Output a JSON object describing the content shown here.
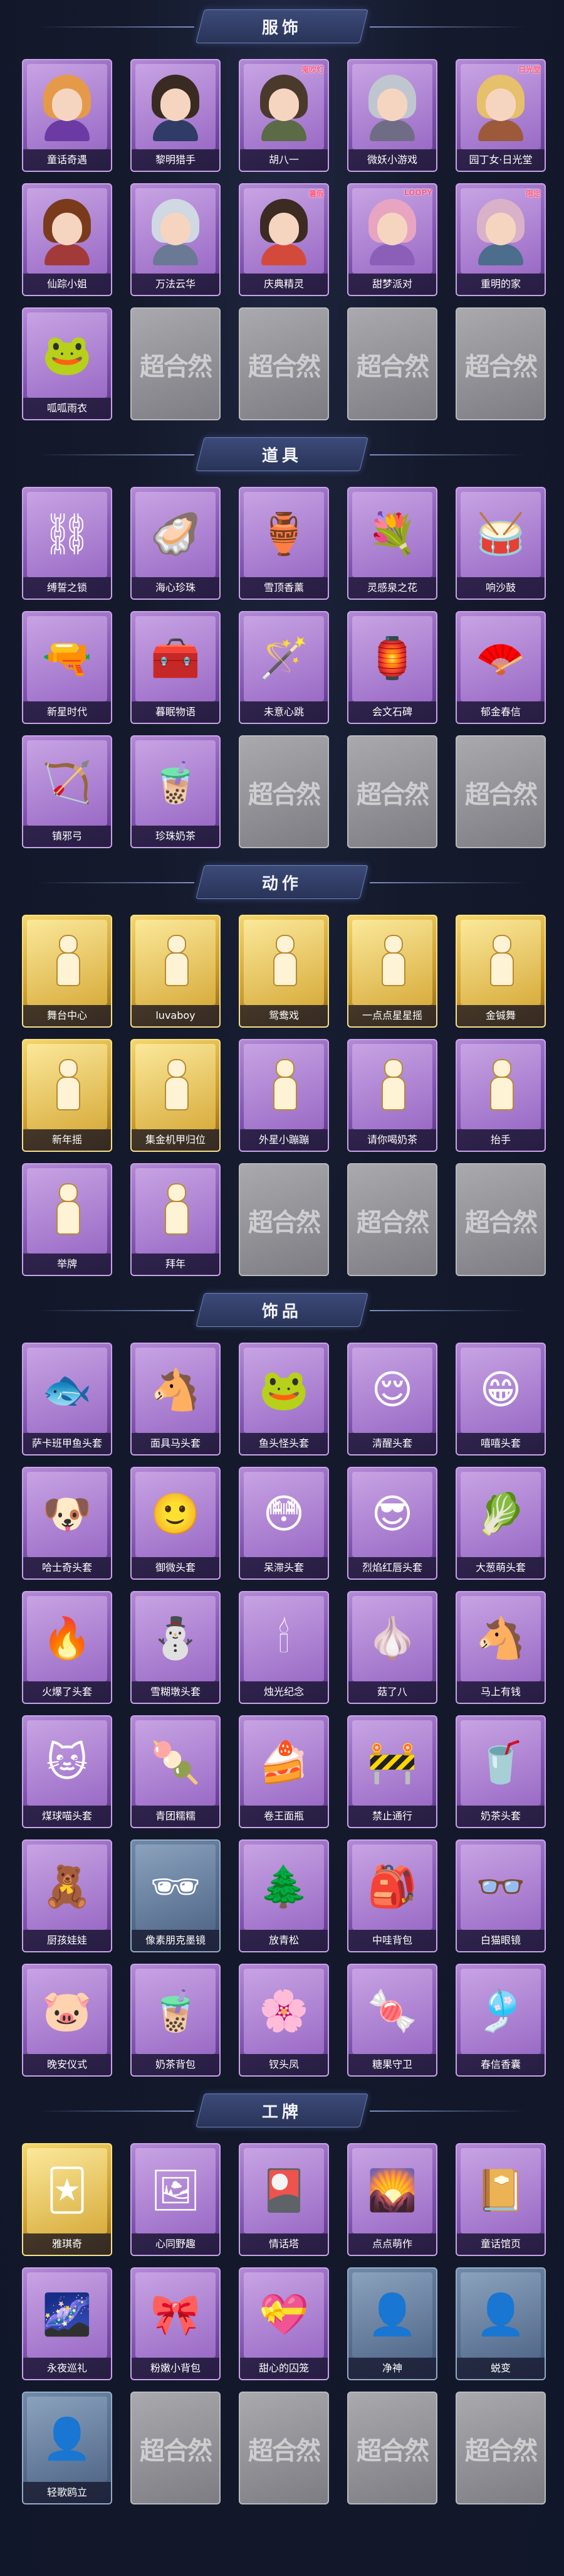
{
  "watermark": "超合然",
  "sections": [
    {
      "title": "服饰",
      "items": [
        {
          "label": "童话奇遇",
          "style": "purple",
          "kind": "portrait",
          "hair": "#e59a4a",
          "body": "#6b3aa3"
        },
        {
          "label": "黎明猎手",
          "style": "purple",
          "kind": "portrait",
          "hair": "#3a2b22",
          "body": "#2f3c66"
        },
        {
          "label": "胡八一",
          "style": "purple",
          "kind": "portrait",
          "hair": "#4a3a2c",
          "body": "#5a6b45",
          "tag": "鬼吹灯"
        },
        {
          "label": "微妖小游戏",
          "style": "purple",
          "kind": "portrait",
          "hair": "#bfc6cf",
          "body": "#6f6d86"
        },
        {
          "label": "园丁女·日光堂",
          "style": "purple",
          "kind": "portrait",
          "hair": "#e6c06a",
          "body": "#9c5a3a",
          "tag": "日光堂"
        },
        {
          "label": "仙踪小姐",
          "style": "purple",
          "kind": "portrait",
          "hair": "#7a3b1c",
          "body": "#a33a3a"
        },
        {
          "label": "万法云华",
          "style": "purple",
          "kind": "portrait",
          "hair": "#cfd8e3",
          "body": "#6a7a94"
        },
        {
          "label": "庆典精灵",
          "style": "purple",
          "kind": "portrait",
          "hair": "#3b2b22",
          "body": "#d34a3a",
          "tag": "暑假"
        },
        {
          "label": "甜梦派对",
          "style": "purple",
          "kind": "portrait",
          "hair": "#e7a5c2",
          "body": "#8b5fb7",
          "tag": "LOOPY"
        },
        {
          "label": "重明的家",
          "style": "purple",
          "kind": "portrait",
          "hair": "#d9b2c9",
          "body": "#4d6d8c",
          "tag": "限定"
        },
        {
          "label": "呱呱雨衣",
          "style": "purple",
          "kind": "emoji",
          "icon": "🐸"
        },
        {
          "label": "",
          "style": "empty"
        },
        {
          "label": "",
          "style": "empty"
        },
        {
          "label": "",
          "style": "empty"
        },
        {
          "label": "",
          "style": "empty"
        }
      ]
    },
    {
      "title": "道具",
      "items": [
        {
          "label": "缚誓之锁",
          "style": "purple",
          "kind": "emoji",
          "icon": "⛓"
        },
        {
          "label": "海心珍珠",
          "style": "purple",
          "kind": "emoji",
          "icon": "🦪"
        },
        {
          "label": "雪顶香薰",
          "style": "purple",
          "kind": "emoji",
          "icon": "🏺"
        },
        {
          "label": "灵感泉之花",
          "style": "purple",
          "kind": "emoji",
          "icon": "💐"
        },
        {
          "label": "响沙鼓",
          "style": "purple",
          "kind": "emoji",
          "icon": "🥁"
        },
        {
          "label": "新星时代",
          "style": "purple",
          "kind": "emoji",
          "icon": "🔫"
        },
        {
          "label": "暮眠物语",
          "style": "purple",
          "kind": "emoji",
          "icon": "🧰"
        },
        {
          "label": "未意心跳",
          "style": "purple",
          "kind": "emoji",
          "icon": "🪄"
        },
        {
          "label": "会文石碑",
          "style": "purple",
          "kind": "emoji",
          "icon": "🏮"
        },
        {
          "label": "郁金春信",
          "style": "purple",
          "kind": "emoji",
          "icon": "🪭"
        },
        {
          "label": "镇邪弓",
          "style": "purple",
          "kind": "emoji",
          "icon": "🏹"
        },
        {
          "label": "珍珠奶茶",
          "style": "purple",
          "kind": "emoji",
          "icon": "🧋"
        },
        {
          "label": "",
          "style": "empty"
        },
        {
          "label": "",
          "style": "empty"
        },
        {
          "label": "",
          "style": "empty"
        }
      ]
    },
    {
      "title": "动作",
      "items": [
        {
          "label": "舞台中心",
          "style": "gold",
          "kind": "pose"
        },
        {
          "label": "luvaboy",
          "style": "gold",
          "kind": "pose"
        },
        {
          "label": "鸳鸯戏",
          "style": "gold",
          "kind": "pose"
        },
        {
          "label": "一点点星星摇",
          "style": "gold",
          "kind": "pose"
        },
        {
          "label": "金铖舞",
          "style": "gold",
          "kind": "pose"
        },
        {
          "label": "新年摇",
          "style": "gold",
          "kind": "pose"
        },
        {
          "label": "集金机甲归位",
          "style": "gold",
          "kind": "pose"
        },
        {
          "label": "外星小蹦蹦",
          "style": "purple",
          "kind": "pose"
        },
        {
          "label": "请你喝奶茶",
          "style": "purple",
          "kind": "pose"
        },
        {
          "label": "抬手",
          "style": "purple",
          "kind": "pose"
        },
        {
          "label": "举牌",
          "style": "purple",
          "kind": "pose"
        },
        {
          "label": "拜年",
          "style": "purple",
          "kind": "pose"
        },
        {
          "label": "",
          "style": "empty"
        },
        {
          "label": "",
          "style": "empty"
        },
        {
          "label": "",
          "style": "empty"
        }
      ]
    },
    {
      "title": "饰品",
      "items": [
        {
          "label": "萨卡班甲鱼头套",
          "style": "purple",
          "kind": "emoji",
          "icon": "🐟"
        },
        {
          "label": "面具马头套",
          "style": "purple",
          "kind": "emoji",
          "icon": "🐴"
        },
        {
          "label": "鱼头怪头套",
          "style": "purple",
          "kind": "emoji",
          "icon": "🐸"
        },
        {
          "label": "清醒头套",
          "style": "purple",
          "kind": "emoji",
          "icon": "😌"
        },
        {
          "label": "嘻嘻头套",
          "style": "purple",
          "kind": "emoji",
          "icon": "😁"
        },
        {
          "label": "哈士奇头套",
          "style": "purple",
          "kind": "emoji",
          "icon": "🐶"
        },
        {
          "label": "御微头套",
          "style": "purple",
          "kind": "emoji",
          "icon": "🙂"
        },
        {
          "label": "呆滞头套",
          "style": "purple",
          "kind": "emoji",
          "icon": "😳"
        },
        {
          "label": "烈焰红唇头套",
          "style": "purple",
          "kind": "emoji",
          "icon": "😎"
        },
        {
          "label": "大葱萌头套",
          "style": "purple",
          "kind": "emoji",
          "icon": "🥬"
        },
        {
          "label": "火爆了头套",
          "style": "purple",
          "kind": "emoji",
          "icon": "🔥"
        },
        {
          "label": "雪糊墩头套",
          "style": "purple",
          "kind": "emoji",
          "icon": "⛄"
        },
        {
          "label": "烛光纪念",
          "style": "purple",
          "kind": "emoji",
          "icon": "🕯"
        },
        {
          "label": "菇了八",
          "style": "purple",
          "kind": "emoji",
          "icon": "🧄"
        },
        {
          "label": "马上有钱",
          "style": "purple",
          "kind": "emoji",
          "icon": "🐴"
        },
        {
          "label": "煤球喵头套",
          "style": "purple",
          "kind": "emoji",
          "icon": "🐱"
        },
        {
          "label": "青团糯糯",
          "style": "purple",
          "kind": "emoji",
          "icon": "🍡"
        },
        {
          "label": "卷王面瓶",
          "style": "purple",
          "kind": "emoji",
          "icon": "🍰"
        },
        {
          "label": "禁止通行",
          "style": "purple",
          "kind": "emoji",
          "icon": "🚧"
        },
        {
          "label": "奶茶头套",
          "style": "purple",
          "kind": "emoji",
          "icon": "🥤"
        },
        {
          "label": "厨孩娃娃",
          "style": "purple",
          "kind": "emoji",
          "icon": "🧸"
        },
        {
          "label": "像素朋克墨镜",
          "style": "blue",
          "kind": "emoji",
          "icon": "🕶"
        },
        {
          "label": "放青松",
          "style": "purple",
          "kind": "emoji",
          "icon": "🌲"
        },
        {
          "label": "中哇背包",
          "style": "purple",
          "kind": "emoji",
          "icon": "🎒"
        },
        {
          "label": "白猫眼镜",
          "style": "purple",
          "kind": "emoji",
          "icon": "👓"
        },
        {
          "label": "晚安仪式",
          "style": "purple",
          "kind": "emoji",
          "icon": "🐷"
        },
        {
          "label": "奶茶背包",
          "style": "purple",
          "kind": "emoji",
          "icon": "🧋"
        },
        {
          "label": "钗头凤",
          "style": "purple",
          "kind": "emoji",
          "icon": "🌸"
        },
        {
          "label": "糖果守卫",
          "style": "purple",
          "kind": "emoji",
          "icon": "🍬"
        },
        {
          "label": "春信香囊",
          "style": "purple",
          "kind": "emoji",
          "icon": "🎐"
        }
      ]
    },
    {
      "title": "工牌",
      "items": [
        {
          "label": "雅琪奇",
          "style": "gold",
          "kind": "emoji",
          "icon": "🃏"
        },
        {
          "label": "心同野趣",
          "style": "purple",
          "kind": "emoji",
          "icon": "🖼"
        },
        {
          "label": "情话塔",
          "style": "purple",
          "kind": "emoji",
          "icon": "🎴"
        },
        {
          "label": "点点萌作",
          "style": "purple",
          "kind": "emoji",
          "icon": "🌄"
        },
        {
          "label": "童话馆页",
          "style": "purple",
          "kind": "emoji",
          "icon": "📔"
        },
        {
          "label": "永夜巡礼",
          "style": "purple",
          "kind": "emoji",
          "icon": "🌌"
        },
        {
          "label": "粉嫩小背包",
          "style": "purple",
          "kind": "emoji",
          "icon": "🎀"
        },
        {
          "label": "甜心的囚笼",
          "style": "purple",
          "kind": "emoji",
          "icon": "💝"
        },
        {
          "label": "净神",
          "style": "blue",
          "kind": "emoji",
          "icon": "👤"
        },
        {
          "label": "蜕变",
          "style": "blue",
          "kind": "emoji",
          "icon": "👤"
        },
        {
          "label": "轻歌鸥立",
          "style": "blue",
          "kind": "emoji",
          "icon": "👤"
        },
        {
          "label": "",
          "style": "empty"
        },
        {
          "label": "",
          "style": "empty"
        },
        {
          "label": "",
          "style": "empty"
        },
        {
          "label": "",
          "style": "empty"
        }
      ]
    }
  ]
}
